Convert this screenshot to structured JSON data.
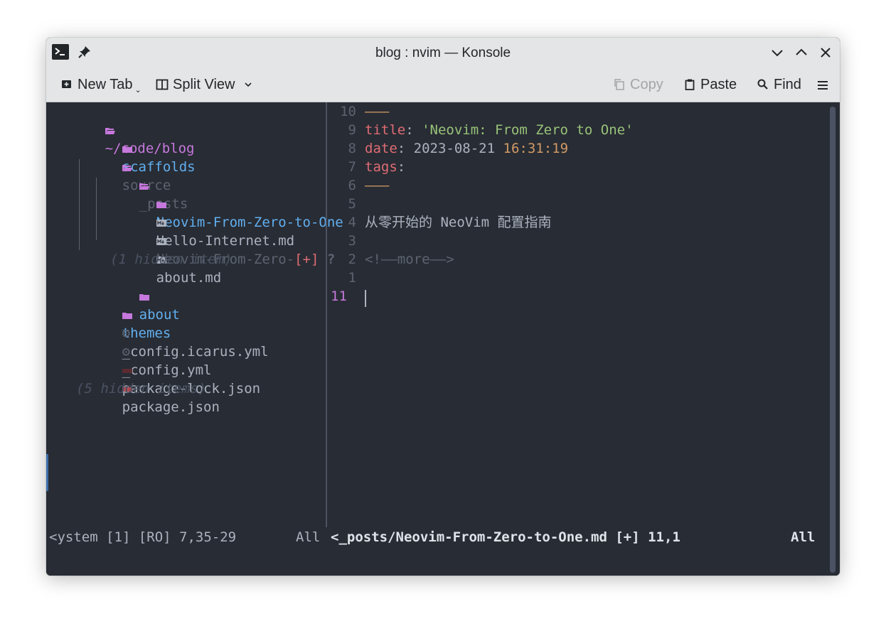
{
  "window": {
    "title": "blog : nvim — Konsole"
  },
  "toolbar": {
    "new_tab": "New Tab",
    "split_view": "Split View",
    "copy": "Copy",
    "paste": "Paste",
    "find": "Find"
  },
  "tree": {
    "root": "~/code/blog",
    "scaffolds": "scaffolds",
    "source": "source",
    "posts": "_posts",
    "post_dir": "Neovim-From-Zero-to-One",
    "hello": "Hello-Internet.md",
    "neovim_file": "Neovim-From-Zero-",
    "modified_mark": "[+]",
    "unknown_mark": "?",
    "about_md": "about.md",
    "hidden_one": "(1 hidden item)",
    "about": "about",
    "themes": "themes",
    "config_icarus": "_config.icarus.yml",
    "config": "_config.yml",
    "package_lock": "package-lock.json",
    "package": "package.json",
    "hidden_five": "(5 hidden items)"
  },
  "editor": {
    "lines": [
      {
        "num": "10",
        "text": "———"
      },
      {
        "num": "9",
        "key": "title",
        "sep": ": ",
        "value": "'Neovim: From Zero to One'"
      },
      {
        "num": "8",
        "key": "date",
        "sep": ": ",
        "value": "2023-08-21 ",
        "time": "16:31:19"
      },
      {
        "num": "7",
        "key": "tags",
        "sep": ":"
      },
      {
        "num": "6",
        "text": "———"
      },
      {
        "num": "5"
      },
      {
        "num": "4",
        "text": "从零开始的 NeoVim 配置指南"
      },
      {
        "num": "3"
      },
      {
        "num": "2",
        "text": "<!——more——>"
      },
      {
        "num": "1"
      },
      {
        "num": "11"
      }
    ]
  },
  "status": {
    "left": "<ystem [1] [RO] 7,35-29",
    "left_pos": "All",
    "right": "<_posts/Neovim-From-Zero-to-One.md [+] 11,1",
    "right_pos": "All"
  },
  "colors": {
    "terminal_bg": "#282c34",
    "titlebar_bg": "#e3e5e7",
    "folder": "#c678dd",
    "directory": "#61afef",
    "key": "#e06c75",
    "string": "#98c379",
    "number": "#d19a66"
  },
  "icons": [
    "terminal-icon",
    "pin-icon",
    "minimize-icon",
    "maximize-icon",
    "close-icon",
    "new-tab-icon",
    "split-view-icon",
    "copy-icon",
    "paste-icon",
    "find-icon",
    "hamburger-menu-icon",
    "folder-icon",
    "markdown-file-icon",
    "gear-icon",
    "npm-icon"
  ]
}
